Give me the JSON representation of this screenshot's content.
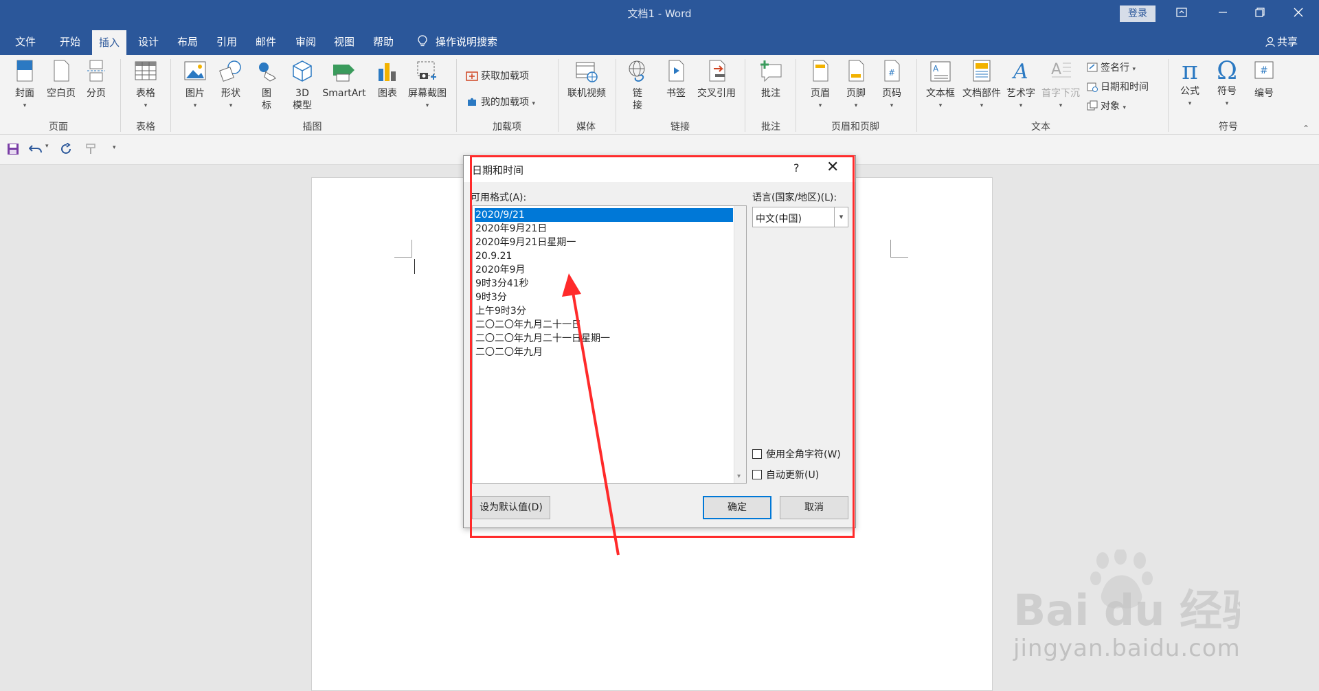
{
  "window": {
    "title": "文档1 - Word",
    "login": "登录"
  },
  "menu": {
    "tabs": [
      "文件",
      "开始",
      "插入",
      "设计",
      "布局",
      "引用",
      "邮件",
      "审阅",
      "视图",
      "帮助"
    ],
    "active_tab": "插入",
    "search": "操作说明搜索",
    "share": "共享"
  },
  "ribbon": {
    "groups": {
      "pages": "页面",
      "tables": "表格",
      "illustrations": "插图",
      "addins": "加载项",
      "media": "媒体",
      "links": "链接",
      "comments": "批注",
      "header_footer": "页眉和页脚",
      "text": "文本",
      "symbols": "符号"
    },
    "buttons": {
      "cover": "封面",
      "blank": "空白页",
      "page_break": "分页",
      "table": "表格",
      "picture": "图片",
      "shapes": "形状",
      "icons_1": "图",
      "icons_2": "标",
      "model_1": "3D",
      "model_2": "模型",
      "smartart": "SmartArt",
      "chart": "图表",
      "screenshot": "屏幕截图",
      "get_addins": "获取加载项",
      "my_addins": "我的加载项",
      "online_video": "联机视频",
      "link_1": "链",
      "link_2": "接",
      "bookmark": "书签",
      "cross_ref": "交叉引用",
      "comment": "批注",
      "header": "页眉",
      "footer": "页脚",
      "page_number": "页码",
      "textbox": "文本框",
      "quick_parts": "文档部件",
      "wordart": "艺术字",
      "drop_cap": "首字下沉",
      "signature": "签名行",
      "datetime": "日期和时间",
      "object": "对象",
      "equation": "公式",
      "symbol": "符号",
      "number": "编号"
    }
  },
  "dialog": {
    "title": "日期和时间",
    "help": "?",
    "close": "✕",
    "formats_label": "可用格式(A):",
    "language_label": "语言(国家/地区)(L):",
    "language_value": "中文(中国)",
    "formats": [
      "2020/9/21",
      "2020年9月21日",
      "2020年9月21日星期一",
      "20.9.21",
      "2020年9月",
      "9时3分41秒",
      "9时3分",
      "上午9时3分",
      "二〇二〇年九月二十一日",
      "二〇二〇年九月二十一日星期一",
      "二〇二〇年九月"
    ],
    "selected_index": 0,
    "fullwidth_label": "使用全角字符(W)",
    "fullwidth_checked": false,
    "auto_update_label": "自动更新(U)",
    "auto_update_checked": false,
    "set_default": "设为默认值(D)",
    "ok": "确定",
    "cancel": "取消"
  },
  "watermark": {
    "logo_text": "Bai du 经验",
    "url": "jingyan.baidu.com"
  },
  "colors": {
    "brand": "#2b579a",
    "selection": "#0078d7",
    "annotation": "#ff2a2a"
  }
}
